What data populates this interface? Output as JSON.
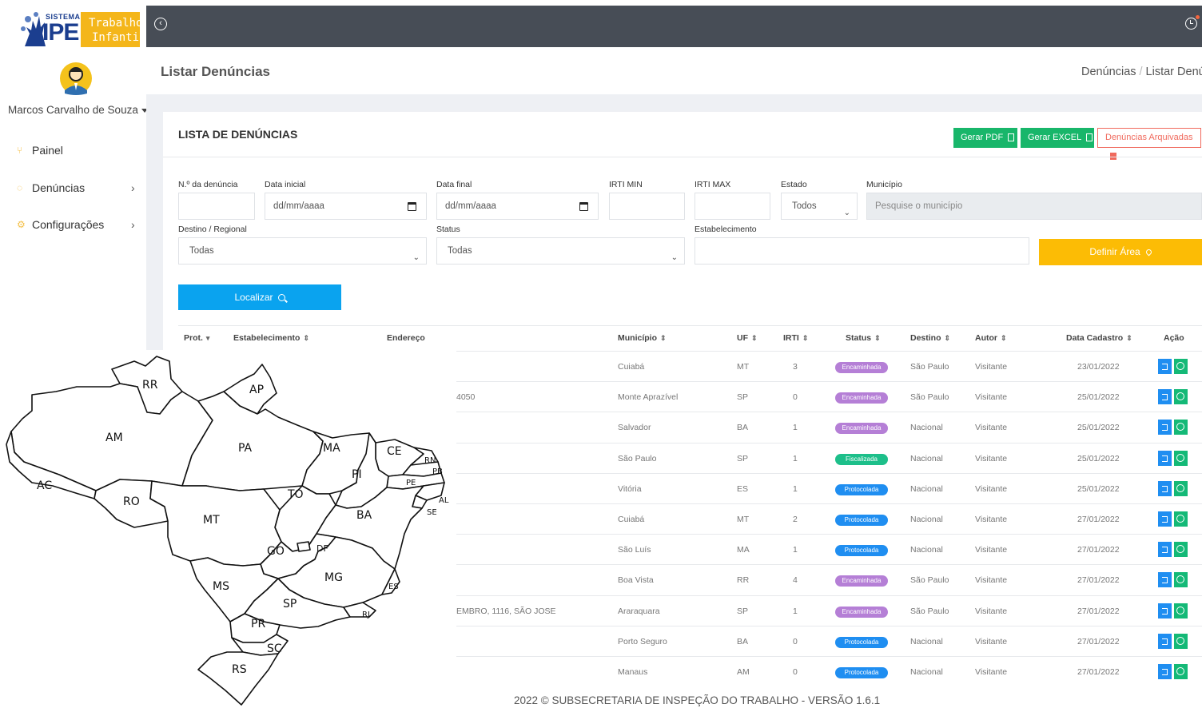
{
  "colors": {
    "topbar": "#474d56",
    "green": "#18b66a",
    "blue": "#0aa3ef",
    "yellow": "#fcbc05",
    "red": "#f06a5d",
    "badge_encaminhada": "#b57fd6",
    "badge_fiscalizada": "#1dbf8a",
    "badge_protocolada": "#1f8ef1"
  },
  "logo": {
    "sistema": "SISTEMA",
    "ipe": "IPE",
    "line1": "Trabalho",
    "line2": "Infantil"
  },
  "user": {
    "name": "Marcos Carvalho de Souza"
  },
  "nav": [
    {
      "label": "Painel",
      "icon": "utensils-icon"
    },
    {
      "label": "Denúncias",
      "icon": "circle-icon",
      "chevron": "›"
    },
    {
      "label": "Configurações",
      "icon": "cog-icon",
      "chevron": "›"
    }
  ],
  "page": {
    "title": "Listar Denúncias",
    "breadcrumb": [
      "Denúncias",
      "Listar Denúncias"
    ]
  },
  "card": {
    "title": "LISTA DE DENÚNCIAS",
    "btn_pdf": "Gerar PDF",
    "btn_excel": "Gerar EXCEL",
    "btn_archived": "Denúncias Arquivadas"
  },
  "filters": {
    "numero_label": "N.º da denúncia",
    "data_inicial_label": "Data inicial",
    "data_inicial_value": "dd/mm/aaaa",
    "data_final_label": "Data final",
    "data_final_value": "dd/mm/aaaa",
    "irti_min_label": "IRTI MIN",
    "irti_max_label": "IRTI MAX",
    "estado_label": "Estado",
    "estado_value": "Todos",
    "municipio_label": "Município",
    "municipio_placeholder": "Pesquise o município",
    "destino_label": "Destino / Regional",
    "destino_value": "Todas",
    "status_label": "Status",
    "status_value": "Todas",
    "estabelecimento_label": "Estabelecimento",
    "btn_area": "Definir Área",
    "btn_localizar": "Localizar"
  },
  "table": {
    "headers": {
      "prot": "Prot.",
      "estabelecimento": "Estabelecimento",
      "endereco": "Endereço",
      "municipio": "Município",
      "uf": "UF",
      "irti": "IRTI",
      "status": "Status",
      "destino": "Destino",
      "autor": "Autor",
      "data": "Data Cadastro",
      "acao": "Ação"
    },
    "rows": [
      {
        "endereco": "",
        "municipio": "Cuiabá",
        "uf": "MT",
        "irti": "3",
        "status": "Encaminhada",
        "destino": "São Paulo",
        "autor": "Visitante",
        "data": "23/01/2022"
      },
      {
        "endereco": "4050",
        "municipio": "Monte Aprazível",
        "uf": "SP",
        "irti": "0",
        "status": "Encaminhada",
        "destino": "São Paulo",
        "autor": "Visitante",
        "data": "25/01/2022"
      },
      {
        "endereco": "",
        "municipio": "Salvador",
        "uf": "BA",
        "irti": "1",
        "status": "Encaminhada",
        "destino": "Nacional",
        "autor": "Visitante",
        "data": "25/01/2022"
      },
      {
        "endereco": "",
        "municipio": "São Paulo",
        "uf": "SP",
        "irti": "1",
        "status": "Fiscalizada",
        "destino": "Nacional",
        "autor": "Visitante",
        "data": "25/01/2022"
      },
      {
        "endereco": "",
        "municipio": "Vitória",
        "uf": "ES",
        "irti": "1",
        "status": "Protocolada",
        "destino": "Nacional",
        "autor": "Visitante",
        "data": "25/01/2022"
      },
      {
        "endereco": "",
        "municipio": "Cuiabá",
        "uf": "MT",
        "irti": "2",
        "status": "Protocolada",
        "destino": "Nacional",
        "autor": "Visitante",
        "data": "27/01/2022"
      },
      {
        "endereco": "",
        "municipio": "São Luís",
        "uf": "MA",
        "irti": "1",
        "status": "Protocolada",
        "destino": "Nacional",
        "autor": "Visitante",
        "data": "27/01/2022"
      },
      {
        "endereco": "",
        "municipio": "Boa Vista",
        "uf": "RR",
        "irti": "4",
        "status": "Encaminhada",
        "destino": "São Paulo",
        "autor": "Visitante",
        "data": "27/01/2022"
      },
      {
        "endereco": "EMBRO, 1116, SÃO JOSE",
        "municipio": "Araraquara",
        "uf": "SP",
        "irti": "1",
        "status": "Encaminhada",
        "destino": "São Paulo",
        "autor": "Visitante",
        "data": "27/01/2022"
      },
      {
        "endereco": "",
        "municipio": "Porto Seguro",
        "uf": "BA",
        "irti": "0",
        "status": "Protocolada",
        "destino": "Nacional",
        "autor": "Visitante",
        "data": "27/01/2022"
      },
      {
        "endereco": "",
        "municipio": "Manaus",
        "uf": "AM",
        "irti": "0",
        "status": "Protocolada",
        "destino": "Nacional",
        "autor": "Visitante",
        "data": "27/01/2022"
      }
    ]
  },
  "map_labels": [
    "RR",
    "AP",
    "AM",
    "PA",
    "MA",
    "CE",
    "RN",
    "PB",
    "PE",
    "PI",
    "AC",
    "RO",
    "TO",
    "AL",
    "SE",
    "MT",
    "BA",
    "GO",
    "DF",
    "MG",
    "MS",
    "ES",
    "SP",
    "RJ",
    "PR",
    "SC",
    "RS"
  ],
  "footer": "2022 © SUBSECRETARIA DE INSPEÇÃO DO TRABALHO - VERSÃO 1.6.1"
}
